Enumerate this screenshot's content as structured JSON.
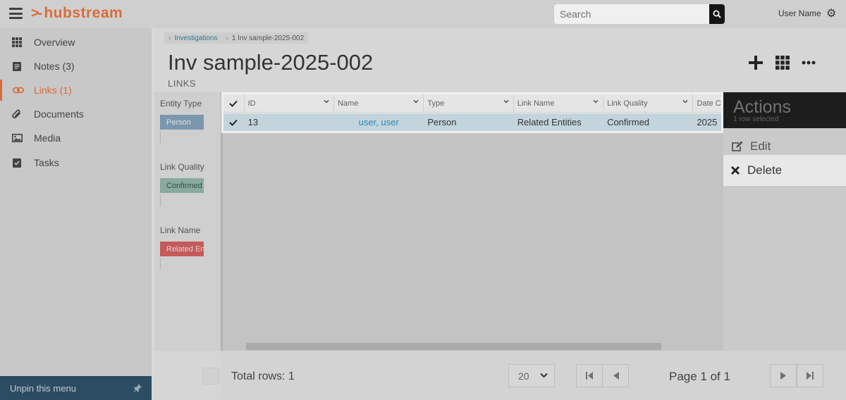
{
  "header": {
    "logo_text": "hubstream",
    "search_placeholder": "Search",
    "user_name": "User Name"
  },
  "sidebar": {
    "items": [
      {
        "label": "Overview",
        "icon": "grid-icon"
      },
      {
        "label": "Notes (3)",
        "icon": "notes-icon"
      },
      {
        "label": "Links (1)",
        "icon": "link-icon",
        "active": true
      },
      {
        "label": "Documents",
        "icon": "paperclip-icon"
      },
      {
        "label": "Media",
        "icon": "image-icon"
      },
      {
        "label": "Tasks",
        "icon": "task-icon"
      }
    ],
    "unpin_label": "Unpin this menu"
  },
  "breadcrumb": {
    "parent": "Investigations",
    "current": "1 Inv sample-2025-002"
  },
  "page": {
    "title": "Inv sample-2025-002",
    "subtitle": "LINKS"
  },
  "filters": [
    {
      "title": "Entity Type",
      "chip": "Person",
      "chip_bg": "#7f9fb7",
      "chip_fg": "#e8eef3"
    },
    {
      "title": "Link Quality",
      "chip": "Confirmed",
      "chip_bg": "#8fb3a8",
      "chip_fg": "#36524a"
    },
    {
      "title": "Link Name",
      "chip": "Related En",
      "chip_bg": "#d15d5d",
      "chip_fg": "#f5dcdc"
    }
  ],
  "grid": {
    "columns": [
      "ID",
      "Name",
      "Type",
      "Link Name",
      "Link Quality",
      "Date C"
    ],
    "rows": [
      {
        "id": "13",
        "name": "user, user",
        "type": "Person",
        "link_name": "Related Entities",
        "link_quality": "Confirmed",
        "date": "2025"
      }
    ]
  },
  "actions": {
    "title": "Actions",
    "subtitle": "1 row selected",
    "items": [
      {
        "label": "Edit",
        "icon": "edit-icon"
      },
      {
        "label": "Delete",
        "icon": "close-icon"
      }
    ]
  },
  "footer": {
    "total_rows": "Total rows: 1",
    "per_page": "20",
    "page_info": "Page 1 of 1"
  },
  "colors": {
    "accent": "#e8703a",
    "selected_row": "#cfe2ea",
    "link": "#2a8fc0"
  }
}
